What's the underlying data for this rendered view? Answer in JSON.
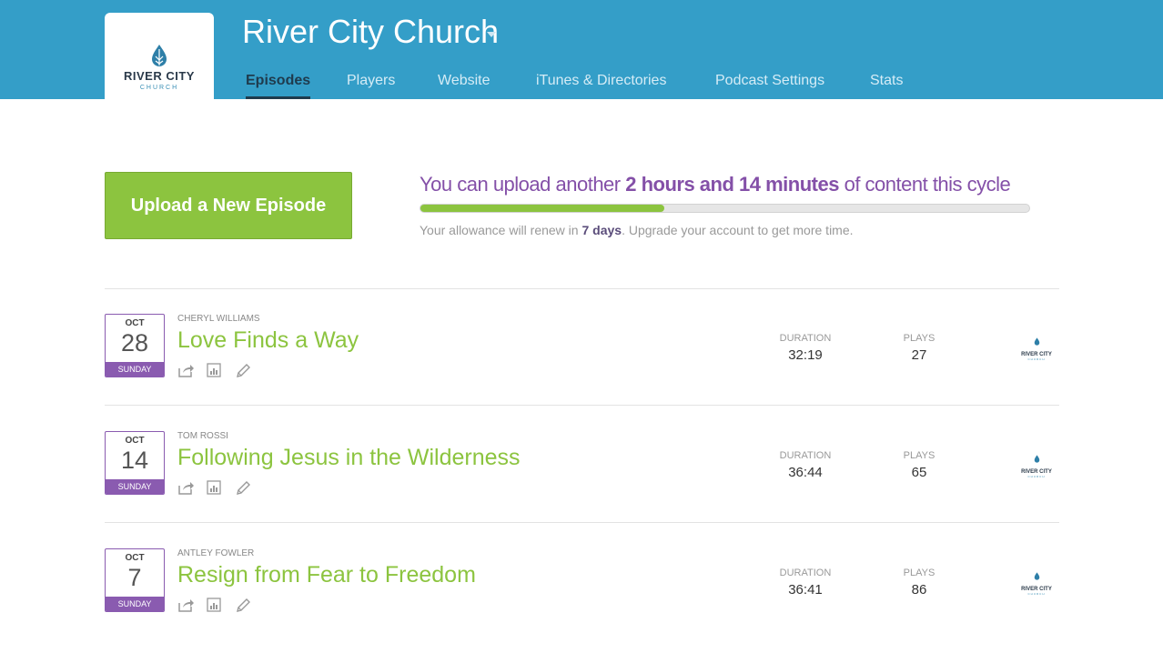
{
  "brand": {
    "logo_main": "RIVER CITY",
    "logo_sub": "CHURCH",
    "site_title": "River City Church",
    "accent_color": "#349ec8"
  },
  "nav": {
    "tabs": [
      {
        "label": "Episodes",
        "active": true
      },
      {
        "label": "Players",
        "active": false
      },
      {
        "label": "Website",
        "active": false
      },
      {
        "label": "iTunes & Directories",
        "active": false
      },
      {
        "label": "Podcast Settings",
        "active": false
      },
      {
        "label": "Stats",
        "active": false
      }
    ]
  },
  "upload": {
    "button_label": "Upload a New Episode",
    "allowance_prefix": "You can upload another ",
    "allowance_amount": "2 hours and 14 minutes",
    "allowance_suffix": " of content this cycle",
    "progress_fraction": 0.4,
    "renew_prefix": "Your allowance will renew in ",
    "renew_days": "7 days",
    "renew_suffix": ". Upgrade your account to get more time."
  },
  "episodes": [
    {
      "month": "OCT",
      "day": "28",
      "weekday": "SUNDAY",
      "author": "CHERYL WILLIAMS",
      "title": "Love Finds a Way",
      "duration_label": "DURATION",
      "duration": "32:19",
      "plays_label": "PLAYS",
      "plays": "27",
      "logo_main": "RIVER CITY",
      "logo_sub": "CHURCH"
    },
    {
      "month": "OCT",
      "day": "14",
      "weekday": "SUNDAY",
      "author": "TOM ROSSI",
      "title": "Following Jesus in the Wilderness",
      "duration_label": "DURATION",
      "duration": "36:44",
      "plays_label": "PLAYS",
      "plays": "65",
      "logo_main": "RIVER CITY",
      "logo_sub": "CHURCH"
    },
    {
      "month": "OCT",
      "day": "7",
      "weekday": "SUNDAY",
      "author": "ANTLEY FOWLER",
      "title": "Resign from Fear to Freedom",
      "duration_label": "DURATION",
      "duration": "36:41",
      "plays_label": "PLAYS",
      "plays": "86",
      "logo_main": "RIVER CITY",
      "logo_sub": "CHURCH"
    }
  ],
  "icons": {
    "share": "share-icon",
    "stats": "bar-chart-icon",
    "edit": "pencil-icon",
    "caret": "caret-down-icon",
    "logo": "water-drop-icon"
  },
  "colors": {
    "green": "#8cc43f",
    "purple": "#8a5bb0"
  }
}
